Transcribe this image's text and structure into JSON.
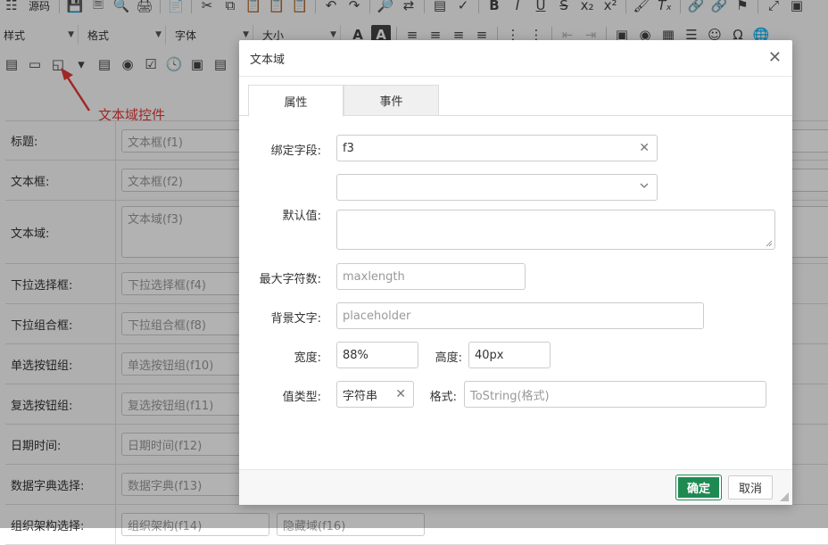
{
  "toolbar": {
    "source_label": "源码",
    "style_combo": "样式",
    "format_combo": "格式",
    "font_combo": "字体",
    "size_combo": "大小"
  },
  "annotation": {
    "label": "文本域控件"
  },
  "form_rows": [
    {
      "label": "标题:",
      "value": "文本框(f1)"
    },
    {
      "label": "文本框:",
      "value": "文本框(f2)"
    },
    {
      "label": "文本域:",
      "value": "文本域(f3)"
    },
    {
      "label": "下拉选择框:",
      "value": "下拉选择框(f4)"
    },
    {
      "label": "下拉组合框:",
      "value": "下拉组合框(f8)"
    },
    {
      "label": "单选按钮组:",
      "value": "单选按钮组(f10)"
    },
    {
      "label": "复选按钮组:",
      "value": "复选按钮组(f11)"
    },
    {
      "label": "日期时间:",
      "value": "日期时间(f12)"
    },
    {
      "label": "数据字典选择:",
      "value": "数据字典(f13)"
    },
    {
      "label": "组织架构选择:",
      "value": "组织架构(f14)",
      "value2": "隐藏域(f16)"
    }
  ],
  "dialog": {
    "title": "文本域",
    "tabs": [
      "属性",
      "事件"
    ],
    "bind_field_label": "绑定字段:",
    "bind_field_value": "f3",
    "default_label": "默认值:",
    "default_select_value": "",
    "default_text_value": "",
    "maxlength_label": "最大字符数:",
    "maxlength_placeholder": "maxlength",
    "placeholder_label": "背景文字:",
    "placeholder_placeholder": "placeholder",
    "width_label": "宽度:",
    "width_value": "88%",
    "height_label": "高度:",
    "height_value": "40px",
    "valuetype_label": "值类型:",
    "valuetype_value": "字符串",
    "format_label": "格式:",
    "format_placeholder": "ToString(格式)",
    "ok_label": "确定",
    "cancel_label": "取消"
  },
  "colors": {
    "accent_green": "#1e8a52",
    "annotation_red": "#e53935"
  }
}
